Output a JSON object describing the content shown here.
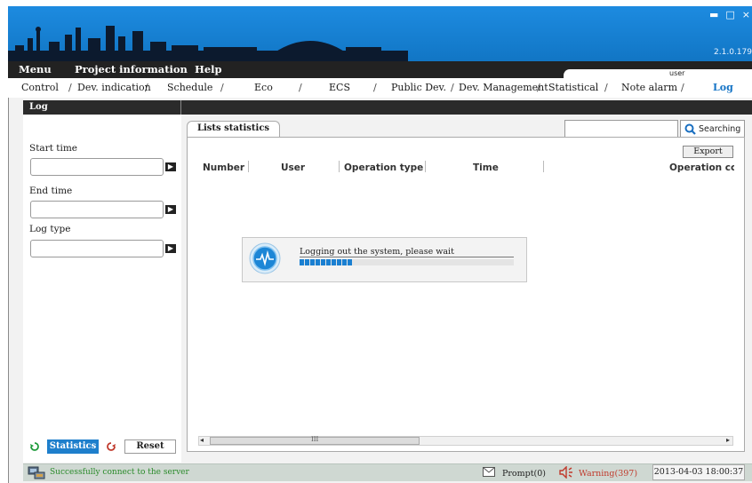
{
  "window": {
    "controls": {
      "minimize": "▬",
      "maximize": "□",
      "close": "×"
    },
    "version": "2.1.0.179",
    "colors": {
      "banner": "#1379c9",
      "accent": "#1473c5",
      "dark_bar": "#2b2b2b"
    }
  },
  "menu": {
    "items": [
      "Menu",
      "Project information",
      "Help"
    ]
  },
  "user": {
    "label": "user"
  },
  "nav": {
    "items": [
      "Control",
      "Dev. indication",
      "Schedule",
      "Eco",
      "ECS",
      "Public Dev.",
      "Dev. Management",
      "Statistical",
      "Note alarm",
      "Log"
    ],
    "active": "Log",
    "separator": "/"
  },
  "section": {
    "title": "Log"
  },
  "filters": {
    "start_time_label": "Start time",
    "start_time_value": "",
    "end_time_label": "End time",
    "end_time_value": "",
    "log_type_label": "Log type",
    "log_type_value": "",
    "picker_glyph": "▶"
  },
  "actions": {
    "statistics": "Statistics",
    "reset": "Reset"
  },
  "tabs": {
    "lists": "Lists statistics"
  },
  "search": {
    "value": "",
    "button": "Searching"
  },
  "export": {
    "label": "Export"
  },
  "table": {
    "columns": [
      "Number",
      "User",
      "Operation type",
      "Time",
      "Operation cc"
    ],
    "rows": []
  },
  "dialog": {
    "message": "Logging out the system, please wait",
    "progress": 0.24,
    "icon": "pulse-icon"
  },
  "scrollbar": {
    "left": "◂",
    "right": "▸",
    "grip": "III"
  },
  "status": {
    "connection": "Successfully connect to the server",
    "prompt": "Prompt(0)",
    "warning": "Warning(397)",
    "datetime": "2013-04-03 18:00:37",
    "warning_color": "#c0392b",
    "ok_color": "#2a8a2a"
  }
}
